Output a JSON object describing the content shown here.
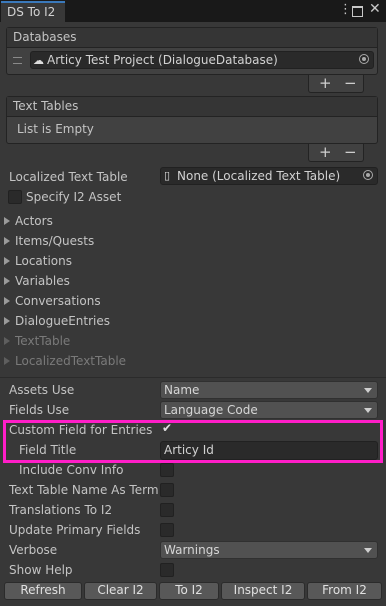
{
  "window": {
    "tab_title": "DS To I2",
    "menu_icon": "kebab-menu-icon",
    "maximize_icon": "maximize-icon",
    "close_icon": "close-icon"
  },
  "databases": {
    "header": "Databases",
    "item_value": "Articy Test Project (DialogueDatabase)",
    "item_icon": "database-icon",
    "add_label": "+",
    "remove_label": "−"
  },
  "text_tables": {
    "header": "Text Tables",
    "empty_text": "List is Empty",
    "add_label": "+",
    "remove_label": "−"
  },
  "localized_text_table": {
    "label": "Localized Text Table",
    "value": "None (Localized Text Table)",
    "icon": "file-icon"
  },
  "specify_i2_asset": {
    "label": "Specify I2 Asset",
    "checked": false
  },
  "sections": [
    {
      "label": "Actors",
      "enabled": true
    },
    {
      "label": "Items/Quests",
      "enabled": true
    },
    {
      "label": "Locations",
      "enabled": true
    },
    {
      "label": "Variables",
      "enabled": true
    },
    {
      "label": "Conversations",
      "enabled": true
    },
    {
      "label": "DialogueEntries",
      "enabled": true
    },
    {
      "label": "TextTable",
      "enabled": false
    },
    {
      "label": "LocalizedTextTable",
      "enabled": false
    }
  ],
  "settings": {
    "assets_use": {
      "label": "Assets Use",
      "value": "Name"
    },
    "fields_use": {
      "label": "Fields Use",
      "value": "Language Code"
    },
    "custom_field": {
      "label": "Custom Field for Entries",
      "checked": true
    },
    "field_title": {
      "label": "Field Title",
      "value": "Articy Id"
    },
    "include_conv_info": {
      "label": "Include Conv Info",
      "checked": false
    },
    "text_table_name_as_term": {
      "label": "Text Table Name As Term",
      "checked": false
    },
    "translations_to_i2": {
      "label": "Translations To I2",
      "checked": false
    },
    "update_primary_fields": {
      "label": "Update Primary Fields",
      "checked": false
    },
    "verbose": {
      "label": "Verbose",
      "value": "Warnings"
    },
    "show_help": {
      "label": "Show Help",
      "checked": false
    }
  },
  "buttons": {
    "refresh": "Refresh",
    "clear_i2": "Clear I2",
    "to_i2": "To I2",
    "inspect_i2": "Inspect I2",
    "from_i2": "From I2"
  },
  "colors": {
    "highlight": "#ff1ec8",
    "tab_accent": "#3a79bb",
    "window_bg": "#383838"
  }
}
